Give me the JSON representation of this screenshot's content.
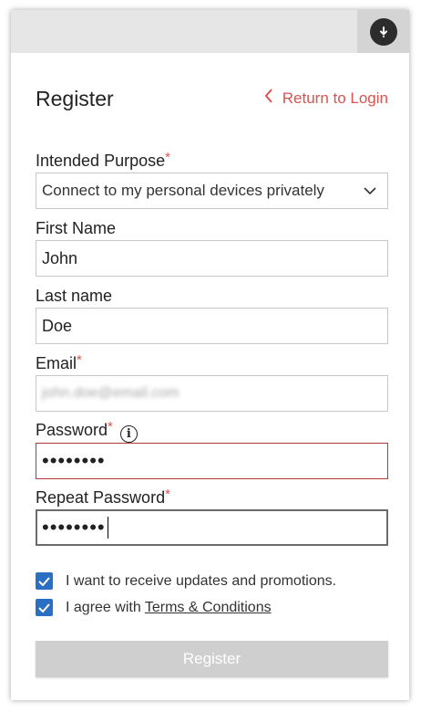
{
  "header": {
    "title": "Register",
    "return_link": "Return to Login"
  },
  "form": {
    "purpose": {
      "label": "Intended Purpose",
      "required": "*",
      "value": "Connect to my personal devices privately"
    },
    "first_name": {
      "label": "First Name",
      "value": "John"
    },
    "last_name": {
      "label": "Last name",
      "value": "Doe"
    },
    "email": {
      "label": "Email",
      "required": "*",
      "value": "john.doe@email.com"
    },
    "password": {
      "label": "Password",
      "required": "*",
      "info": "i",
      "value": "••••••••"
    },
    "repeat_password": {
      "label": "Repeat Password",
      "required": "*",
      "value": "••••••••"
    }
  },
  "checkboxes": {
    "updates": {
      "label": "I want to receive updates and promotions.",
      "checked": true
    },
    "terms": {
      "prefix": "I agree with ",
      "link": "Terms & Conditions",
      "checked": true
    }
  },
  "submit": {
    "label": "Register"
  },
  "colors": {
    "accent_red": "#d9534f",
    "checkbox_blue": "#2b6fc2",
    "button_disabled": "#cfcfcf"
  }
}
